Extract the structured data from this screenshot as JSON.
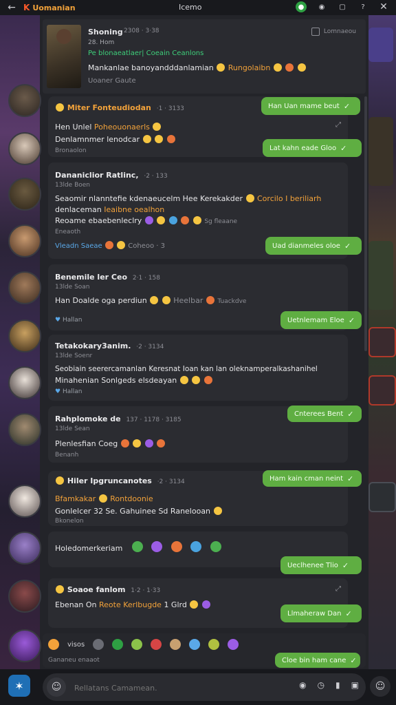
{
  "topbar": {
    "app_name": "Uomanian",
    "center_title": "Icemo"
  },
  "pinned": {
    "title": "Shoning",
    "time": "2308 · 3·38",
    "subtitle": "28. Hom",
    "tag": "Pe blonaeatlaer| Coeain Ceanlons",
    "body": "Mankanlae banoyandddanlamian",
    "body_highlight": "Rungolaibn",
    "footer": "Uoaner Gaute",
    "right_label": "Lomnaeou"
  },
  "cards": [
    {
      "title": "Miter Fonteudiodan",
      "meta": "·1 · 3133",
      "line1_a": "Hen Unlel",
      "line1_b": "Poheouonaerls",
      "line2": "Denlamnmer lenodcar",
      "sub": "Bronaolon"
    },
    {
      "title": "Dananiclior Ratlinc,",
      "meta": "·2 · 133",
      "sub": "13lde Boen",
      "line1_a": "Seaomir nlanntefie kdenaeucelm Hee Kerekakder",
      "line1_b": "Corcilo I beriliarh",
      "line2_a": "denlaceman",
      "line2_b": "Ieaibne oealhon",
      "line3_a": "Reoame ebaebenleclry",
      "line3_b": "Sg fleaane",
      "line4": "Eneaoth",
      "link_a": "Vleadn Saeae",
      "link_b": "Coheoo · 3"
    },
    {
      "title": "Benemile ler Ceo",
      "meta": "2·1 · 158",
      "sub": "13lde Soan",
      "line1_a": "Han Doalde oga perdiun",
      "line1_b": "Heelbar",
      "line1_c": "Tuackdve",
      "react": "Hallan"
    },
    {
      "title": "Tetakokary3anim.",
      "meta": "·2 · 3134",
      "sub": "13lde Soenr",
      "line1": "Seobiain seerercamanlan Keresnat Ioan kan lan oleknamperalkashanihel",
      "line2": "Minahenian Sonlgeds elsdeayan",
      "react": "Hallan"
    },
    {
      "title": "Rahplomoke de",
      "meta": "137 · 1178 · 3185",
      "sub": "13lde Sean",
      "line1": "Plenlesfian Coeg",
      "line2": "Benanh"
    },
    {
      "title": "Hiler Ipgruncanotes",
      "meta": "·2 · 3134",
      "line1_a": "Bfamkakar",
      "line1_b": "Rontdoonie",
      "line2_a": "Gonlelcer 32 Se. Gahuinee Sd",
      "line2_b": "Ranelooan",
      "line3": "Bkonelon"
    },
    {
      "title": "",
      "meta": "",
      "line1": "Holedomerkeriam"
    },
    {
      "title": "Soaoe fanlom",
      "meta": "1·2 · 1·33",
      "line1_a": "Ebenan On",
      "line1_b": "Reote Kerlbugde",
      "line1_c": "1 Glrd"
    }
  ],
  "outgoing": [
    {
      "text": "Han Uan mame beut"
    },
    {
      "text": "Lat kahn eade Gloo"
    },
    {
      "text": "Uad dianmeles oloe"
    },
    {
      "text": "Uetnlemam Eloe"
    },
    {
      "text": "Cnterees Bent"
    },
    {
      "text": "Ham kain cman neint"
    },
    {
      "text": "Ueclhenee Tlio"
    },
    {
      "text": "Llmaheraw Dan"
    },
    {
      "text": "Cloe bin ham cane"
    }
  ],
  "reactbar": {
    "label": "visos",
    "sub": "Gananeu enaaot"
  },
  "composer": {
    "placeholder": "Rellatans Camamean."
  }
}
